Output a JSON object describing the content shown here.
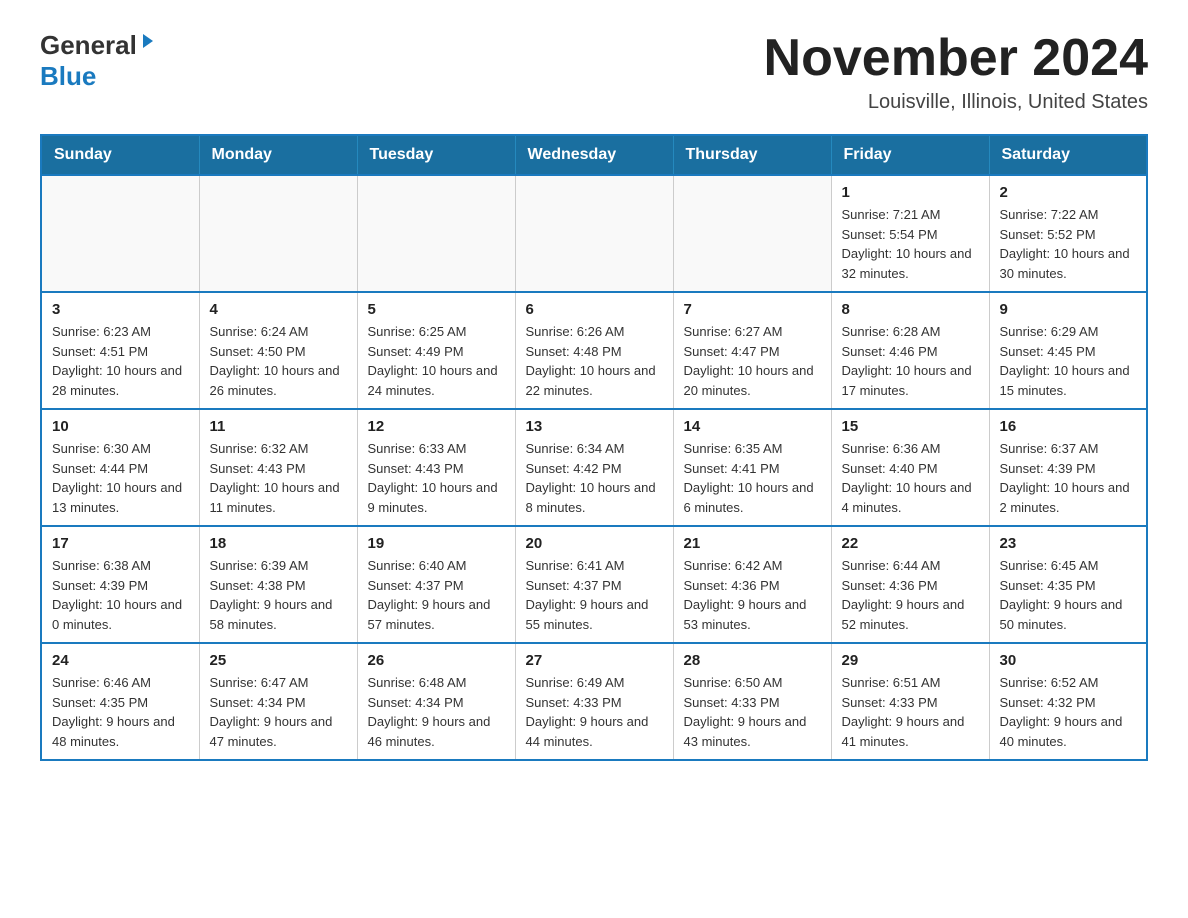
{
  "header": {
    "logo_general": "General",
    "logo_blue": "Blue",
    "title": "November 2024",
    "subtitle": "Louisville, Illinois, United States"
  },
  "calendar": {
    "days_of_week": [
      "Sunday",
      "Monday",
      "Tuesday",
      "Wednesday",
      "Thursday",
      "Friday",
      "Saturday"
    ],
    "weeks": [
      {
        "days": [
          {
            "number": "",
            "info": ""
          },
          {
            "number": "",
            "info": ""
          },
          {
            "number": "",
            "info": ""
          },
          {
            "number": "",
            "info": ""
          },
          {
            "number": "",
            "info": ""
          },
          {
            "number": "1",
            "info": "Sunrise: 7:21 AM\nSunset: 5:54 PM\nDaylight: 10 hours and 32 minutes."
          },
          {
            "number": "2",
            "info": "Sunrise: 7:22 AM\nSunset: 5:52 PM\nDaylight: 10 hours and 30 minutes."
          }
        ]
      },
      {
        "days": [
          {
            "number": "3",
            "info": "Sunrise: 6:23 AM\nSunset: 4:51 PM\nDaylight: 10 hours and 28 minutes."
          },
          {
            "number": "4",
            "info": "Sunrise: 6:24 AM\nSunset: 4:50 PM\nDaylight: 10 hours and 26 minutes."
          },
          {
            "number": "5",
            "info": "Sunrise: 6:25 AM\nSunset: 4:49 PM\nDaylight: 10 hours and 24 minutes."
          },
          {
            "number": "6",
            "info": "Sunrise: 6:26 AM\nSunset: 4:48 PM\nDaylight: 10 hours and 22 minutes."
          },
          {
            "number": "7",
            "info": "Sunrise: 6:27 AM\nSunset: 4:47 PM\nDaylight: 10 hours and 20 minutes."
          },
          {
            "number": "8",
            "info": "Sunrise: 6:28 AM\nSunset: 4:46 PM\nDaylight: 10 hours and 17 minutes."
          },
          {
            "number": "9",
            "info": "Sunrise: 6:29 AM\nSunset: 4:45 PM\nDaylight: 10 hours and 15 minutes."
          }
        ]
      },
      {
        "days": [
          {
            "number": "10",
            "info": "Sunrise: 6:30 AM\nSunset: 4:44 PM\nDaylight: 10 hours and 13 minutes."
          },
          {
            "number": "11",
            "info": "Sunrise: 6:32 AM\nSunset: 4:43 PM\nDaylight: 10 hours and 11 minutes."
          },
          {
            "number": "12",
            "info": "Sunrise: 6:33 AM\nSunset: 4:43 PM\nDaylight: 10 hours and 9 minutes."
          },
          {
            "number": "13",
            "info": "Sunrise: 6:34 AM\nSunset: 4:42 PM\nDaylight: 10 hours and 8 minutes."
          },
          {
            "number": "14",
            "info": "Sunrise: 6:35 AM\nSunset: 4:41 PM\nDaylight: 10 hours and 6 minutes."
          },
          {
            "number": "15",
            "info": "Sunrise: 6:36 AM\nSunset: 4:40 PM\nDaylight: 10 hours and 4 minutes."
          },
          {
            "number": "16",
            "info": "Sunrise: 6:37 AM\nSunset: 4:39 PM\nDaylight: 10 hours and 2 minutes."
          }
        ]
      },
      {
        "days": [
          {
            "number": "17",
            "info": "Sunrise: 6:38 AM\nSunset: 4:39 PM\nDaylight: 10 hours and 0 minutes."
          },
          {
            "number": "18",
            "info": "Sunrise: 6:39 AM\nSunset: 4:38 PM\nDaylight: 9 hours and 58 minutes."
          },
          {
            "number": "19",
            "info": "Sunrise: 6:40 AM\nSunset: 4:37 PM\nDaylight: 9 hours and 57 minutes."
          },
          {
            "number": "20",
            "info": "Sunrise: 6:41 AM\nSunset: 4:37 PM\nDaylight: 9 hours and 55 minutes."
          },
          {
            "number": "21",
            "info": "Sunrise: 6:42 AM\nSunset: 4:36 PM\nDaylight: 9 hours and 53 minutes."
          },
          {
            "number": "22",
            "info": "Sunrise: 6:44 AM\nSunset: 4:36 PM\nDaylight: 9 hours and 52 minutes."
          },
          {
            "number": "23",
            "info": "Sunrise: 6:45 AM\nSunset: 4:35 PM\nDaylight: 9 hours and 50 minutes."
          }
        ]
      },
      {
        "days": [
          {
            "number": "24",
            "info": "Sunrise: 6:46 AM\nSunset: 4:35 PM\nDaylight: 9 hours and 48 minutes."
          },
          {
            "number": "25",
            "info": "Sunrise: 6:47 AM\nSunset: 4:34 PM\nDaylight: 9 hours and 47 minutes."
          },
          {
            "number": "26",
            "info": "Sunrise: 6:48 AM\nSunset: 4:34 PM\nDaylight: 9 hours and 46 minutes."
          },
          {
            "number": "27",
            "info": "Sunrise: 6:49 AM\nSunset: 4:33 PM\nDaylight: 9 hours and 44 minutes."
          },
          {
            "number": "28",
            "info": "Sunrise: 6:50 AM\nSunset: 4:33 PM\nDaylight: 9 hours and 43 minutes."
          },
          {
            "number": "29",
            "info": "Sunrise: 6:51 AM\nSunset: 4:33 PM\nDaylight: 9 hours and 41 minutes."
          },
          {
            "number": "30",
            "info": "Sunrise: 6:52 AM\nSunset: 4:32 PM\nDaylight: 9 hours and 40 minutes."
          }
        ]
      }
    ]
  }
}
